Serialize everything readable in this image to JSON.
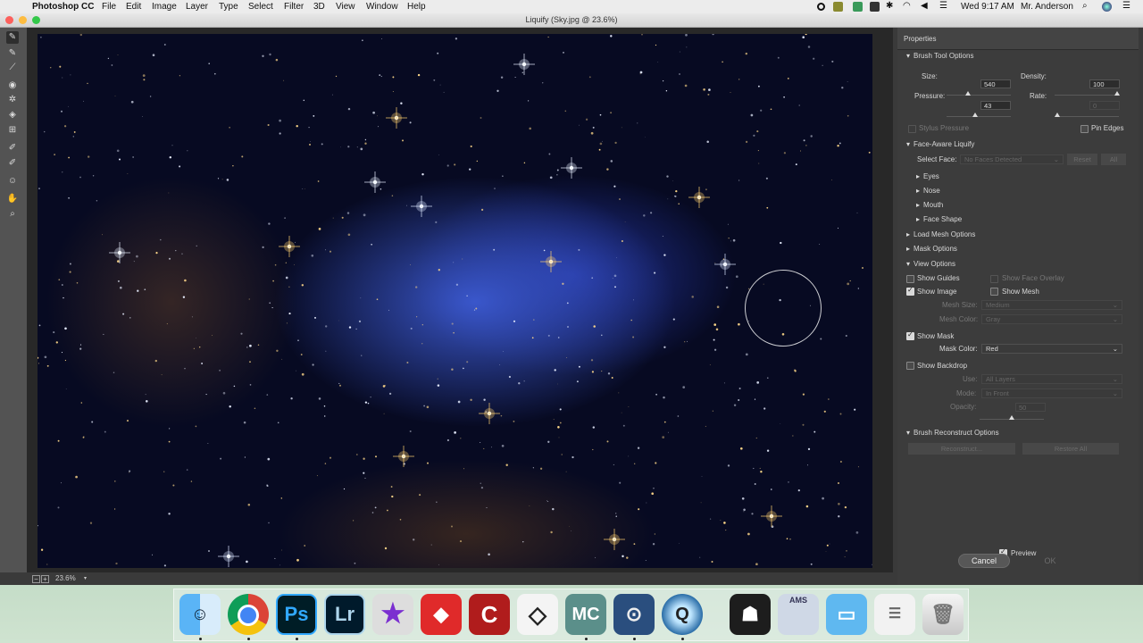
{
  "menubar": {
    "app_name": "Photoshop CC",
    "items": [
      "File",
      "Edit",
      "Image",
      "Layer",
      "Type",
      "Select",
      "Filter",
      "3D",
      "View",
      "Window",
      "Help"
    ],
    "clock": "Wed 9:17 AM",
    "user": "Mr. Anderson"
  },
  "window": {
    "title": "Liquify (Sky.jpg @ 23.6%)"
  },
  "statusbar": {
    "zoom": "23.6%"
  },
  "properties": {
    "panel_title": "Properties",
    "brush_tool_options": {
      "title": "Brush Tool Options",
      "size_label": "Size:",
      "size_value": "540",
      "density_label": "Density:",
      "density_value": "100",
      "pressure_label": "Pressure:",
      "pressure_value": "43",
      "rate_label": "Rate:",
      "rate_value": "0",
      "stylus_pressure_label": "Stylus Pressure",
      "pin_edges_label": "Pin Edges"
    },
    "face_aware": {
      "title": "Face-Aware Liquify",
      "select_face_label": "Select Face:",
      "select_face_value": "No Faces Detected",
      "reset_label": "Reset",
      "all_label": "All",
      "subsections": [
        "Eyes",
        "Nose",
        "Mouth",
        "Face Shape"
      ]
    },
    "load_mesh_title": "Load Mesh Options",
    "mask_options_title": "Mask Options",
    "view_options": {
      "title": "View Options",
      "show_guides": "Show Guides",
      "show_face_overlay": "Show Face Overlay",
      "show_image": "Show Image",
      "show_mesh": "Show Mesh",
      "mesh_size_label": "Mesh Size:",
      "mesh_size_value": "Medium",
      "mesh_color_label": "Mesh Color:",
      "mesh_color_value": "Gray",
      "show_mask": "Show Mask",
      "mask_color_label": "Mask Color:",
      "mask_color_value": "Red",
      "show_backdrop": "Show Backdrop",
      "use_label": "Use:",
      "use_value": "All Layers",
      "mode_label": "Mode:",
      "mode_value": "In Front",
      "opacity_label": "Opacity:",
      "opacity_value": "50"
    },
    "reconstruct": {
      "title": "Brush Reconstruct Options",
      "reconstruct_label": "Reconstruct...",
      "restore_all_label": "Restore All"
    },
    "preview_label": "Preview",
    "cancel_label": "Cancel",
    "ok_label": "OK"
  },
  "dock": {
    "photoshop_label": "Ps",
    "lightroom_label": "Lr",
    "mc_label": "MC",
    "ams_label": "AMS"
  },
  "colors": {
    "panel_bg": "#3c3c3c",
    "canvas_bg": "#070a22",
    "ps_blue": "#31a8ff",
    "lr_blue": "#add5ec"
  }
}
